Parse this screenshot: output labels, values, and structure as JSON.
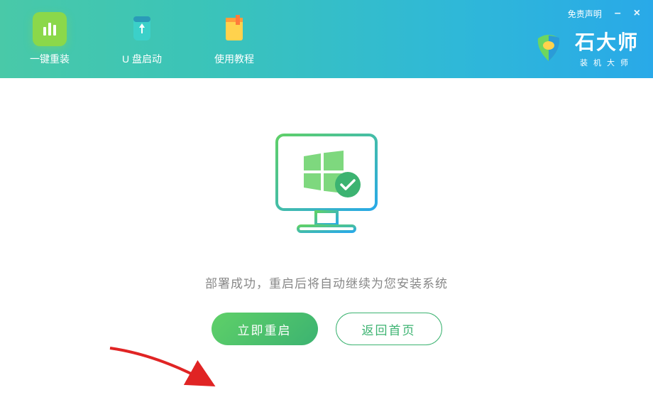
{
  "header": {
    "tabs": [
      {
        "label": "一键重装"
      },
      {
        "label": "U 盘启动"
      },
      {
        "label": "使用教程"
      }
    ],
    "disclaimer": "免责声明",
    "brand_name": "石大师",
    "brand_sub": "装机大师"
  },
  "main": {
    "status_text": "部署成功，重启后将自动继续为您安装系统",
    "restart_label": "立即重启",
    "home_label": "返回首页"
  },
  "colors": {
    "primary_green": "#3cb371",
    "accent_green": "#8bd84a"
  }
}
